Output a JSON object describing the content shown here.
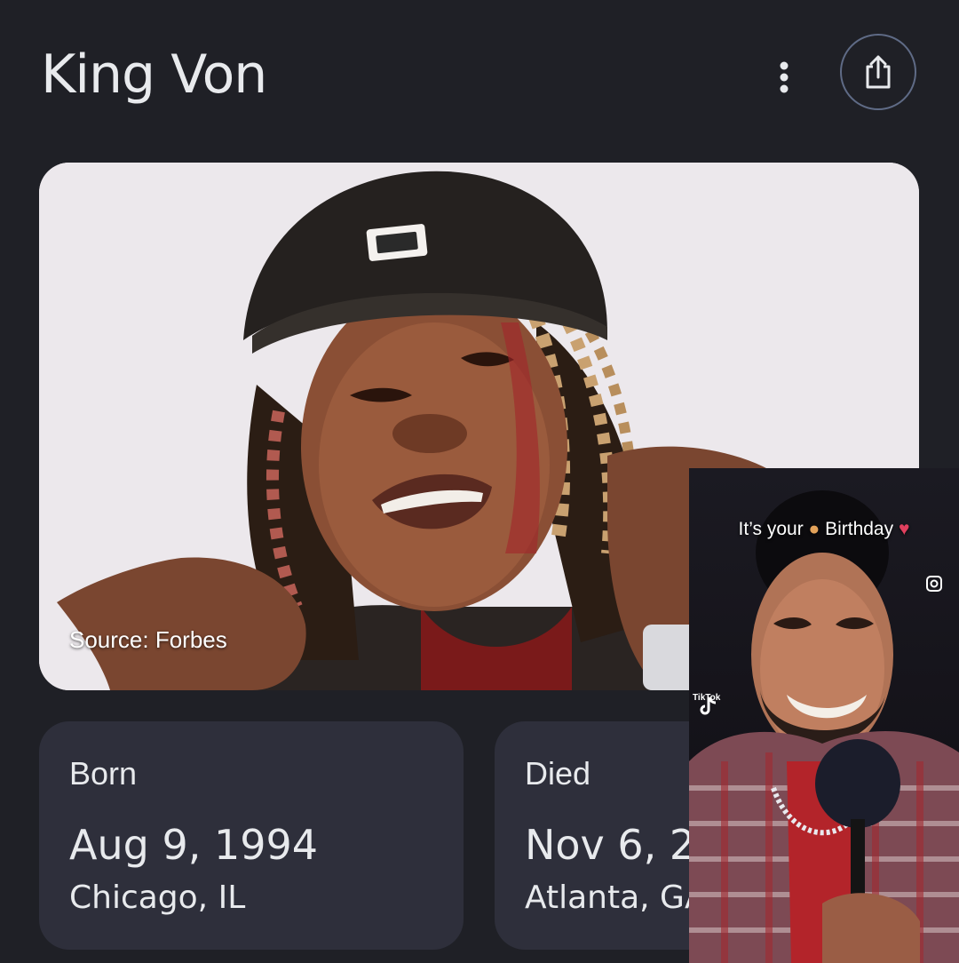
{
  "header": {
    "title": "King Von",
    "more_icon": "more-vert-icon",
    "share_icon": "share-icon"
  },
  "photo": {
    "source": "Source: Forbes"
  },
  "facts": {
    "born": {
      "label": "Born",
      "date": "Aug 9, 1994",
      "place": "Chicago, IL"
    },
    "died": {
      "label": "Died",
      "date": "Nov 6, 2",
      "place": "Atlanta, GA"
    }
  },
  "overlay_video": {
    "caption_start": "It’s your",
    "caption_end": "Birthday",
    "watermark": "TikTok",
    "icons": [
      "instagram-icon",
      "tiktok-icon"
    ]
  },
  "colors": {
    "background": "#1f2026",
    "card": "#2e2f3b",
    "text": "#e8eaed",
    "share_border": "#5f6b86"
  }
}
